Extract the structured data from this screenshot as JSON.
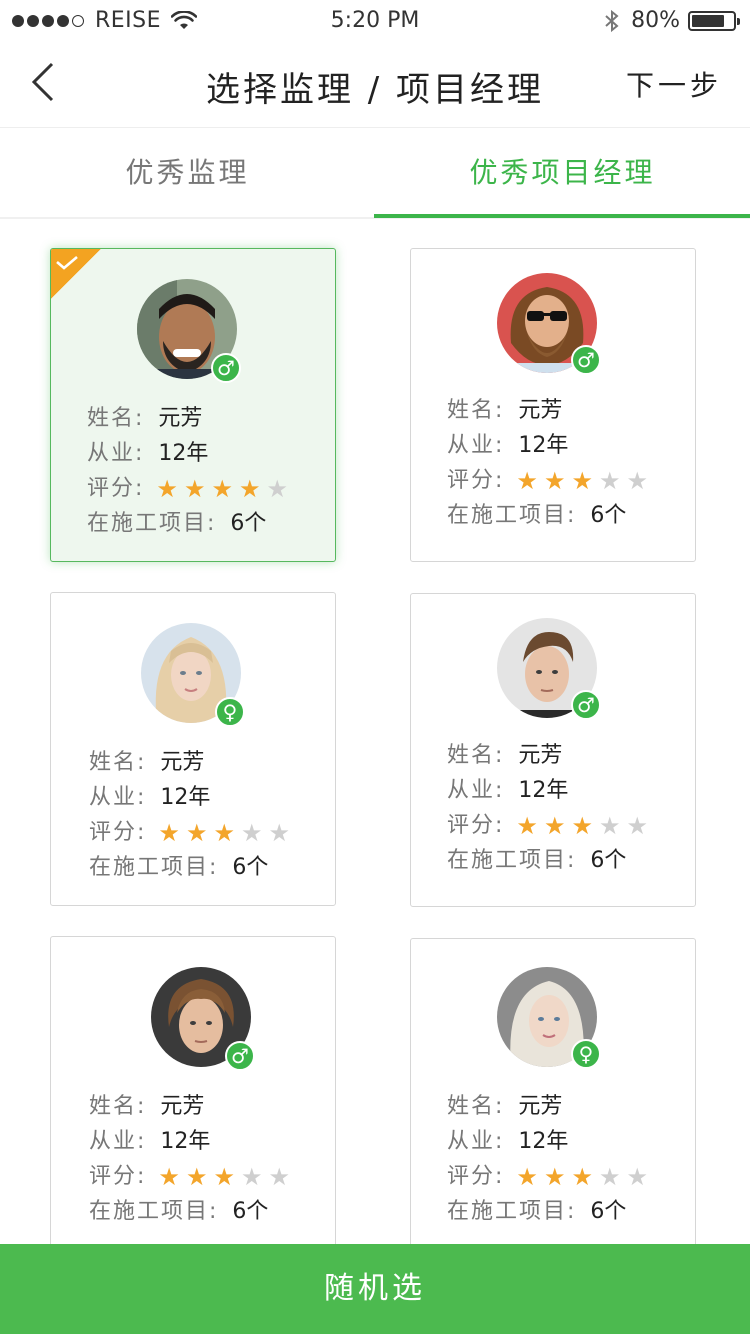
{
  "status_bar": {
    "carrier": "REISE",
    "time": "5:20 PM",
    "battery": "80%",
    "battery_level": 0.8
  },
  "nav": {
    "title": "选择监理 / 项目经理",
    "next_label": "下一步"
  },
  "tabs": [
    {
      "label": "优秀监理",
      "active": false
    },
    {
      "label": "优秀项目经理",
      "active": true
    }
  ],
  "labels": {
    "name": "姓名:",
    "experience": "从业:",
    "rating": "评分:",
    "projects": "在施工项目:"
  },
  "cards": [
    {
      "name": "元芳",
      "experience": "12年",
      "rating": 4,
      "projects": "6个",
      "gender": "♂",
      "selected": true
    },
    {
      "name": "元芳",
      "experience": "12年",
      "rating": 3,
      "projects": "6个",
      "gender": "♂",
      "selected": false
    },
    {
      "name": "元芳",
      "experience": "12年",
      "rating": 3,
      "projects": "6个",
      "gender": "♀",
      "selected": false
    },
    {
      "name": "元芳",
      "experience": "12年",
      "rating": 3,
      "projects": "6个",
      "gender": "♂",
      "selected": false
    },
    {
      "name": "元芳",
      "experience": "12年",
      "rating": 3,
      "projects": "6个",
      "gender": "♂",
      "selected": false
    },
    {
      "name": "元芳",
      "experience": "12年",
      "rating": 3,
      "projects": "6个",
      "gender": "♀",
      "selected": false
    }
  ],
  "rating_max": 5,
  "bottom_button": "随机选",
  "colors": {
    "accent": "#3cb54a",
    "star_on": "#f3a52b",
    "star_off": "#cfcfcf",
    "selected_corner": "#f3a321"
  }
}
